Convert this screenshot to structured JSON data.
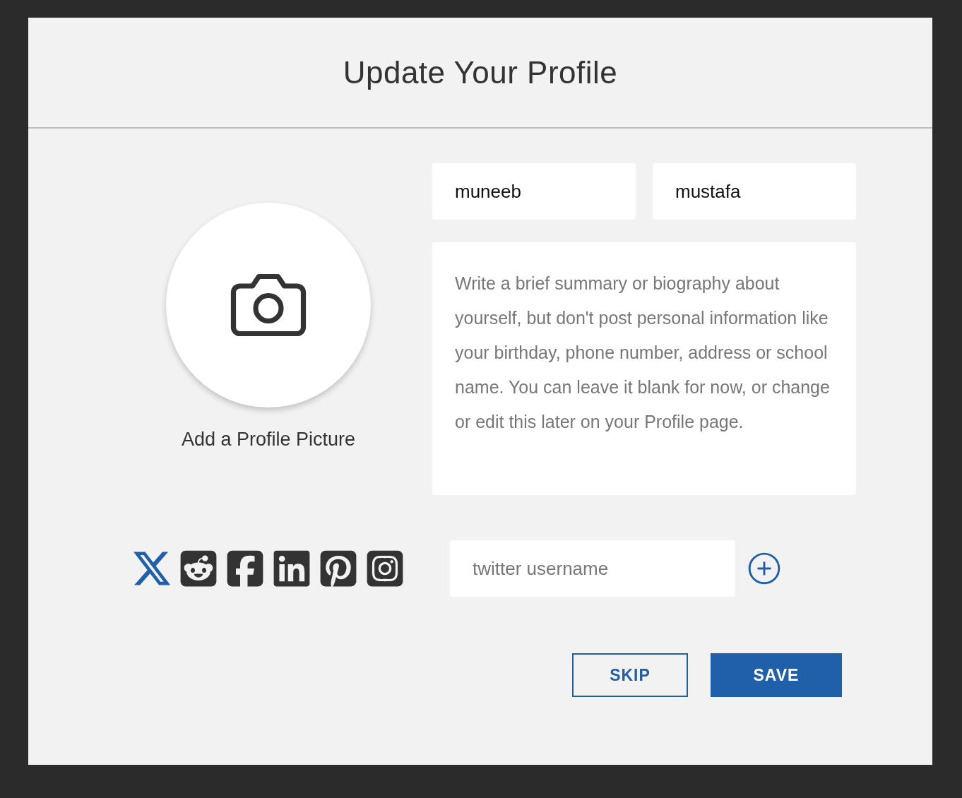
{
  "title": "Update Your Profile",
  "avatar": {
    "label": "Add a Profile Picture"
  },
  "first_name": {
    "value": "muneeb"
  },
  "last_name": {
    "value": "mustafa"
  },
  "bio": {
    "placeholder": "Write a brief summary or biography about yourself, but don't post personal information like your birthday, phone number, address or school name. You can leave it blank for now, or change or edit this later on your Profile page."
  },
  "social_networks": [
    {
      "kind": "x",
      "selected": true
    },
    {
      "kind": "reddit",
      "selected": false
    },
    {
      "kind": "facebook",
      "selected": false
    },
    {
      "kind": "linkedin",
      "selected": false
    },
    {
      "kind": "pinterest",
      "selected": false
    },
    {
      "kind": "instagram",
      "selected": false
    }
  ],
  "social_input": {
    "placeholder": "twitter username"
  },
  "buttons": [
    {
      "kind": "secondary",
      "label": "SKIP"
    },
    {
      "kind": "primary",
      "label": "SAVE"
    }
  ]
}
